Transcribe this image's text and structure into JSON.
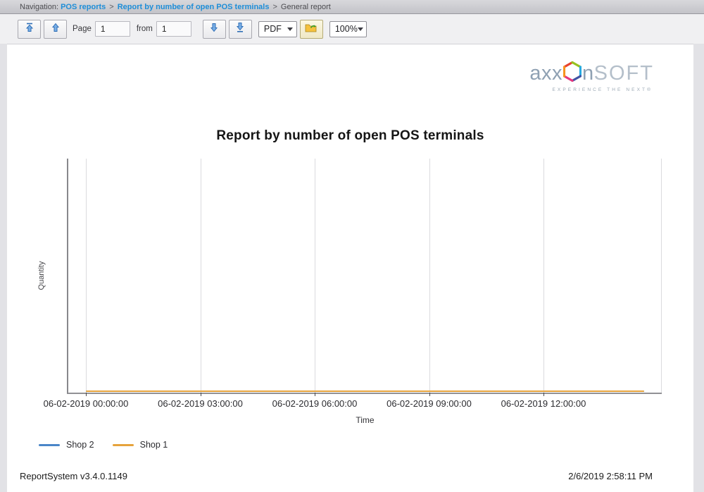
{
  "nav": {
    "prefix": "Navigation: ",
    "links": [
      "POS reports",
      "Report by number of open POS terminals"
    ],
    "separator": ">",
    "current": "General report"
  },
  "toolbar": {
    "page_label": "Page",
    "page_value": "1",
    "from_label": "from",
    "pages_total_value": "1",
    "export_format_value": "PDF",
    "zoom_value": "100%"
  },
  "logo": {
    "word_start": "axx",
    "word_end": "n",
    "word_suffix": "SOFT",
    "tagline": "EXPERIENCE THE NEXT®"
  },
  "report": {
    "title": "Report by number of open POS terminals",
    "footer_left": "ReportSystem v3.4.0.1149",
    "footer_right": "2/6/2019 2:58:11 PM"
  },
  "chart_data": {
    "type": "line",
    "title": "Report by number of open POS terminals",
    "xlabel": "Time",
    "ylabel": "Quantity",
    "x_ticks": [
      "06-02-2019 00:00:00",
      "06-02-2019 03:00:00",
      "06-02-2019 06:00:00",
      "06-02-2019 09:00:00",
      "06-02-2019 12:00:00"
    ],
    "x_range": [
      "06-02-2019 00:00:00",
      "06-02-2019 14:40:00"
    ],
    "grid": "vertical-only",
    "legend_position": "bottom-left",
    "series": [
      {
        "name": "Shop 2",
        "color": "#4a86c8",
        "x": [
          "06-02-2019 00:00:00",
          "06-02-2019 14:40:00"
        ],
        "values": [
          1,
          1
        ]
      },
      {
        "name": "Shop 1",
        "color": "#e6a33c",
        "x": [
          "06-02-2019 00:00:00",
          "06-02-2019 14:40:00"
        ],
        "values": [
          1,
          1
        ]
      }
    ]
  }
}
